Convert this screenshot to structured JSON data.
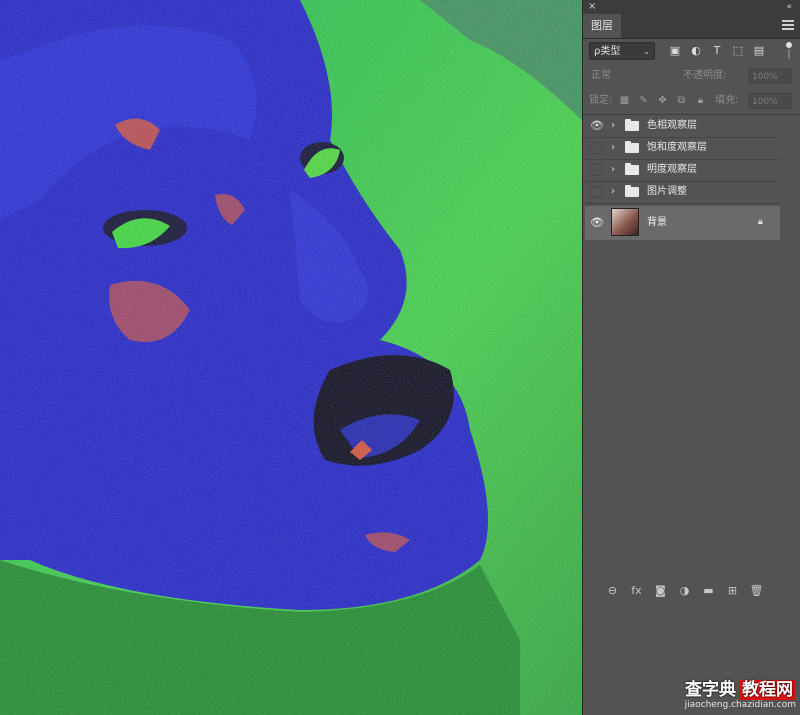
{
  "panel": {
    "close_glyph": "×",
    "collapse_glyph": "«",
    "tab_label": "图层",
    "filter": {
      "label": "ρ类型",
      "chevron": "⌄"
    },
    "filter_icons": [
      "image-filter-icon",
      "adjustment-filter-icon",
      "type-filter-icon",
      "shape-filter-icon",
      "smart-object-filter-icon"
    ],
    "blend_mode": "正常",
    "opacity_label": "不透明度:",
    "opacity_value": "100%",
    "lock_label": "锁定:",
    "fill_label": "填充:",
    "fill_value": "100%",
    "layers": [
      {
        "name": "色相观察层",
        "visible": true
      },
      {
        "name": "饱和度观察层",
        "visible": false
      },
      {
        "name": "明度观察层",
        "visible": false
      },
      {
        "name": "图片调整",
        "visible": false
      }
    ],
    "background_layer": {
      "name": "背景",
      "locked": true
    },
    "bottom_icons": [
      "link-layers-icon",
      "fx-icon",
      "add-mask-icon",
      "new-adjustment-icon",
      "new-group-icon",
      "new-layer-icon",
      "delete-layer-icon"
    ]
  },
  "watermark": {
    "brand": "查字典",
    "badge": "教程网",
    "url": "jiaocheng.chazidian.com"
  }
}
